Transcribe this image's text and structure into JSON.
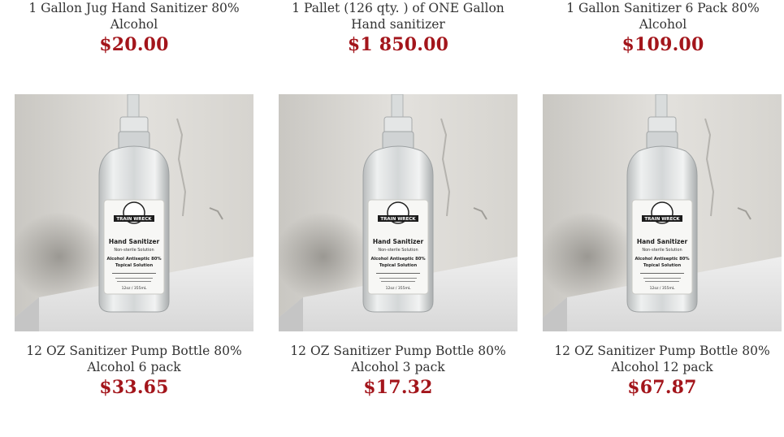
{
  "top_row": [
    {
      "title": "1 Gallon Jug Hand Sanitizer 80% Alcohol",
      "price": "$20.00"
    },
    {
      "title": "1 Pallet (126 qty. ) of ONE Gallon Hand sanitizer",
      "price": "$1 850.00"
    },
    {
      "title": "1 Gallon Sanitizer 6 Pack 80% Alcohol",
      "price": "$109.00"
    }
  ],
  "bottom_row": [
    {
      "title": "12 OZ Sanitizer Pump Bottle 80% Alcohol 6 pack",
      "price": "$33.65"
    },
    {
      "title": "12 OZ Sanitizer Pump Bottle 80% Alcohol 3 pack",
      "price": "$17.32"
    },
    {
      "title": "12 OZ Sanitizer Pump Bottle 80% Alcohol 12 pack",
      "price": "$67.87"
    }
  ],
  "bottle_label": {
    "brand": "TRAIN WRECK",
    "product": "Hand Sanitizer",
    "sub": "Non-sterile Solution",
    "line1": "Alcohol Antiseptic 80%",
    "line2": "Topical Solution",
    "size": "12oz / 355mL"
  },
  "colors": {
    "price": "#a3151b",
    "title": "#333333"
  }
}
